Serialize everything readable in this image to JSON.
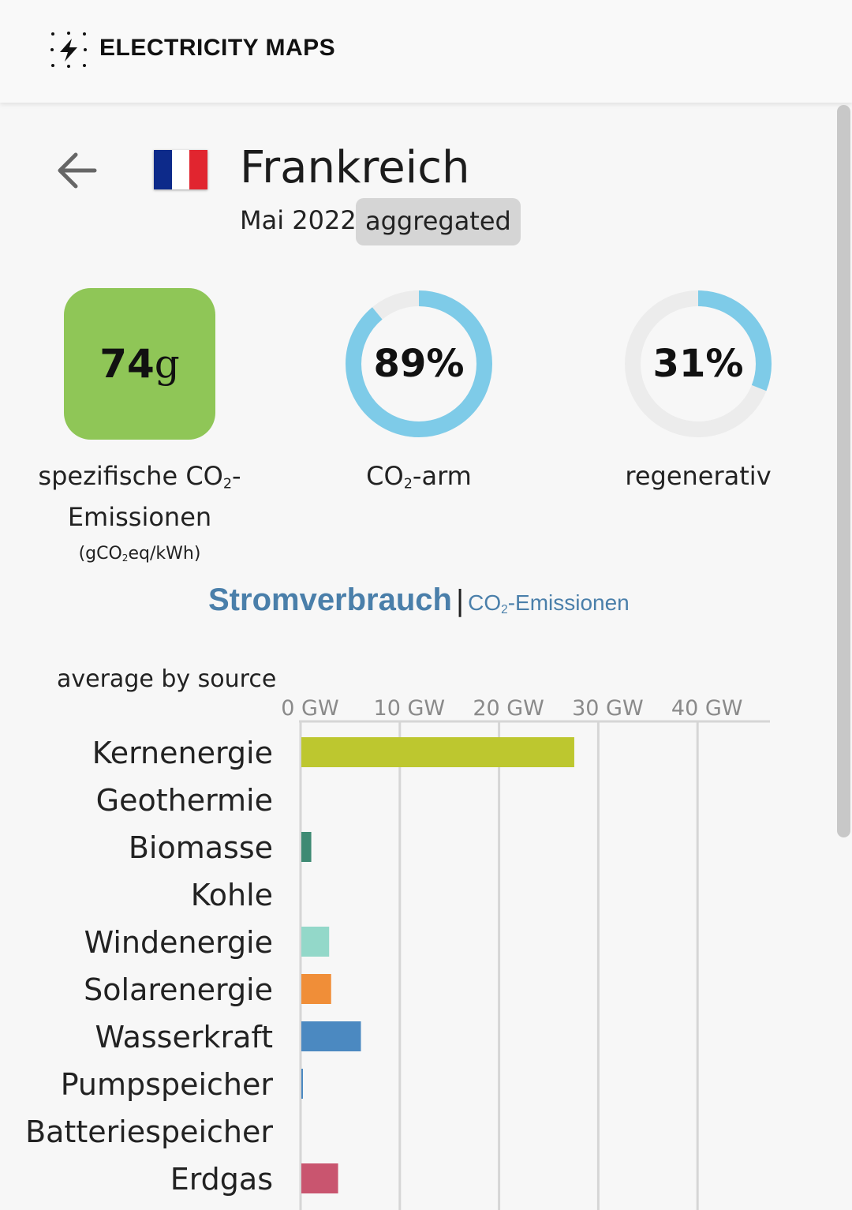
{
  "header": {
    "logo_text": "ELECTRICITY MAPS",
    "logo_icon": "lightning-bolt-icon"
  },
  "zone": {
    "name": "Frankreich",
    "date": "Mai 2022",
    "badge": "aggregated",
    "flag_colors": [
      "#0d2a8a",
      "#ffffff",
      "#e1252f"
    ]
  },
  "metrics": {
    "co2_intensity": {
      "value": "74",
      "unit": "g",
      "caption_line1": "spezifische CO",
      "caption_sub": "2",
      "caption_line1_end": "-",
      "caption_line2": "Emissionen",
      "unit_caption": "(gCO",
      "unit_caption_sub": "2",
      "unit_caption_end": "eq/kWh)",
      "color": "#8fc657"
    },
    "low_carbon": {
      "value": "89%",
      "fraction": 0.89,
      "caption_pre": "CO",
      "caption_sub": "2",
      "caption_post": "-arm"
    },
    "renewable": {
      "value": "31%",
      "fraction": 0.31,
      "caption": "regenerativ"
    },
    "ring_color": "#7ecbe8",
    "ring_track_color": "#ececec"
  },
  "toggle": {
    "active": "Stromverbrauch",
    "separator": "|",
    "inactive_pre": "CO",
    "inactive_sub": "2",
    "inactive_post": "-Emissionen"
  },
  "chart_data": {
    "type": "bar",
    "orientation": "horizontal",
    "title": "average by source",
    "xlim": [
      0,
      47
    ],
    "ticks": [
      0,
      10,
      20,
      30,
      40
    ],
    "tick_labels": [
      "0 GW",
      "10 GW",
      "20 GW",
      "30 GW",
      "40 GW"
    ],
    "grid": true,
    "categories": [
      "Kernenergie",
      "Geothermie",
      "Biomasse",
      "Kohle",
      "Windenergie",
      "Solarenergie",
      "Wasserkraft",
      "Pumpspeicher",
      "Batteriespeicher",
      "Erdgas"
    ],
    "values": [
      27.5,
      0,
      1.0,
      0,
      2.8,
      3.0,
      6.0,
      0.1,
      0,
      3.7
    ],
    "colors": [
      "#bdc72f",
      "#c9a36b",
      "#3e8a73",
      "#666666",
      "#93d8c9",
      "#f08e38",
      "#4b89c1",
      "#4b89c1",
      "#7b6fb0",
      "#c9556f"
    ]
  }
}
